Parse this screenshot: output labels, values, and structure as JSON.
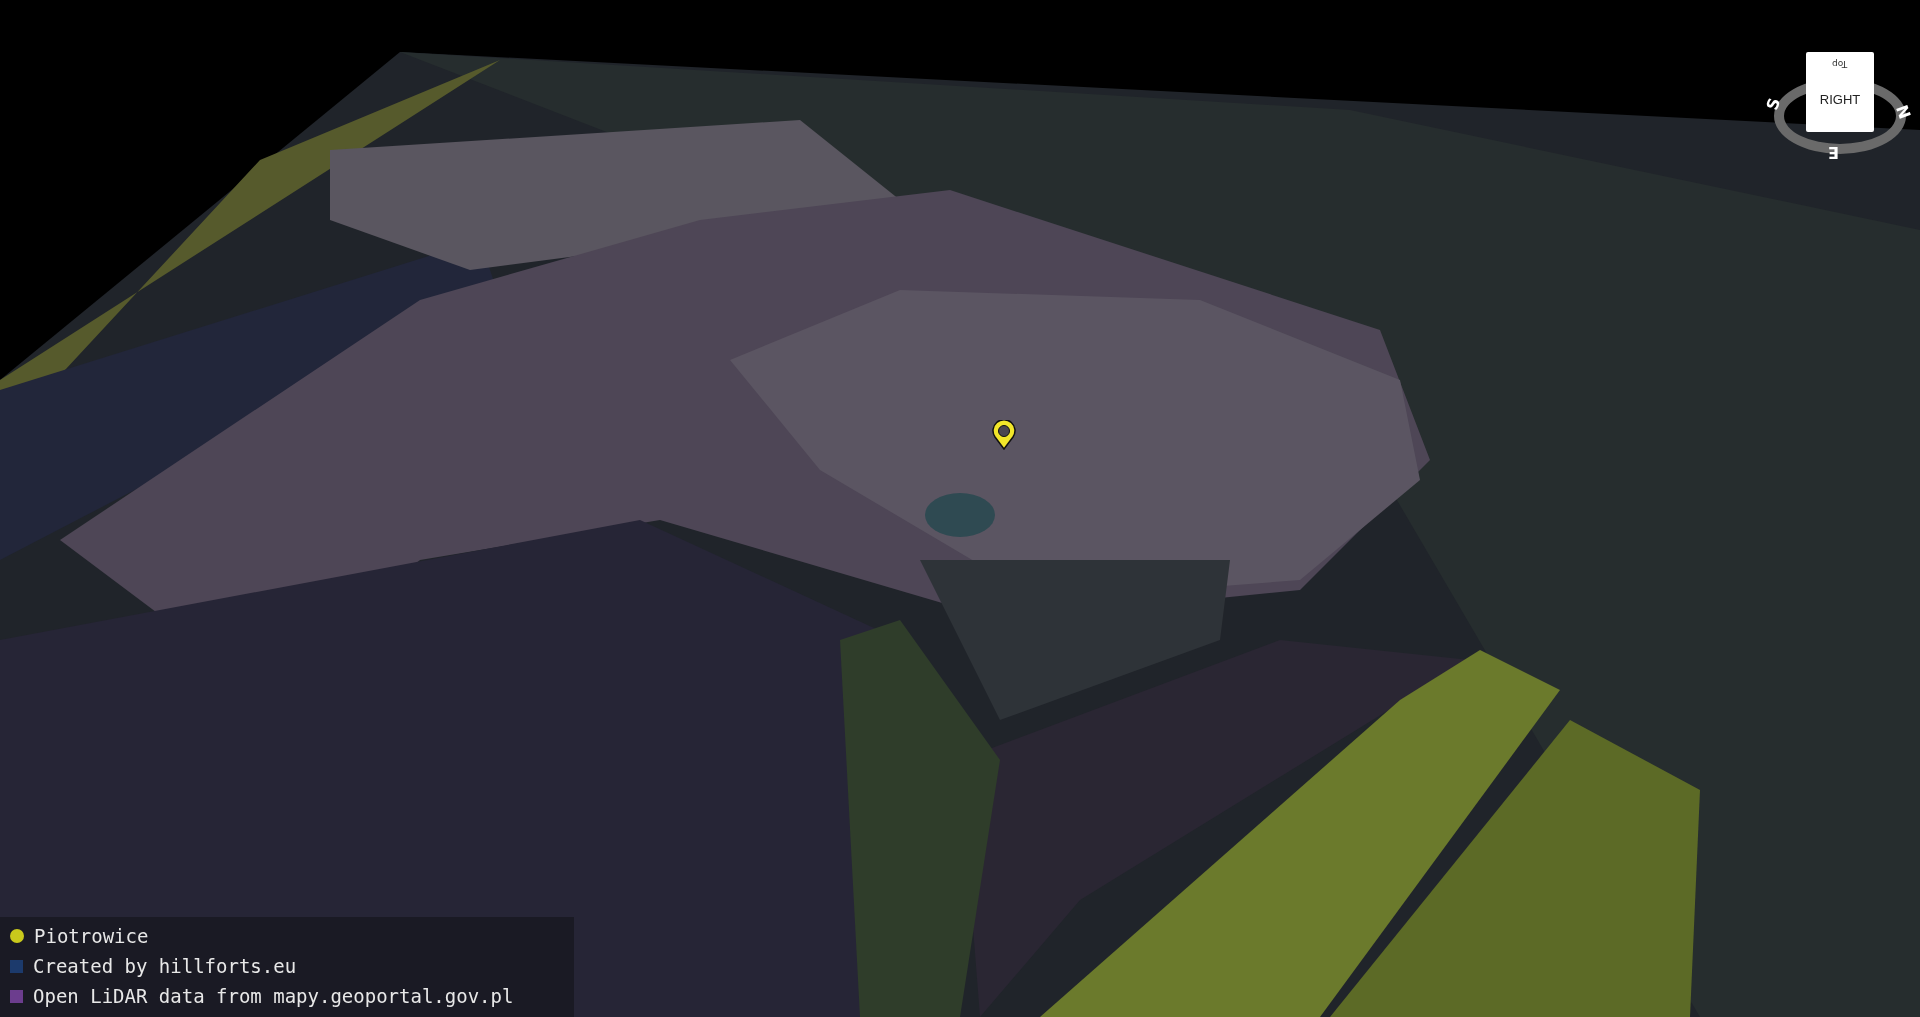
{
  "legend": [
    {
      "label": "Piotrowice",
      "kind": "dot",
      "color": "#c9c91c"
    },
    {
      "label": "Created by hillforts.eu",
      "kind": "square",
      "color": "#1c3a6c"
    },
    {
      "label": "Open LiDAR data from mapy.geoportal.gov.pl",
      "kind": "square",
      "color": "#6c3d8e"
    }
  ],
  "navigation_cube": {
    "face": "RIGHT",
    "top_face": "Top",
    "compass": [
      "S",
      "N",
      "E"
    ]
  }
}
